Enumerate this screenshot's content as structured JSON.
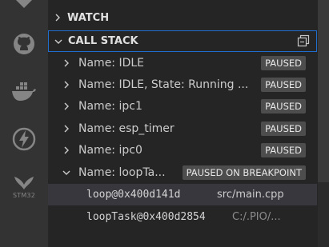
{
  "activity_bar": {
    "icons": [
      "extensions-icon",
      "github-icon",
      "docker-icon",
      "lightning-icon",
      "stm32-icon"
    ],
    "stm32_label": "STM32"
  },
  "sections": {
    "watch_title": "WATCH",
    "call_stack_title": "CALL STACK"
  },
  "threads": [
    {
      "label": "Name: IDLE",
      "status": "PAUSED",
      "expanded": false
    },
    {
      "label": "Name: IDLE, State: Running ...",
      "status": "PAUSED",
      "expanded": false
    },
    {
      "label": "Name: ipc1",
      "status": "PAUSED",
      "expanded": false
    },
    {
      "label": "Name: esp_timer",
      "status": "PAUSED",
      "expanded": false
    },
    {
      "label": "Name: ipc0",
      "status": "PAUSED",
      "expanded": false
    },
    {
      "label": "Name: loopTa...",
      "status": "PAUSED ON BREAKPOINT",
      "expanded": true
    }
  ],
  "frames": [
    {
      "name": "loop@0x400d141d",
      "source": "src/main.cpp",
      "selected": true
    },
    {
      "name": "loopTask@0x400d2854",
      "source": "C:/.PIO/...",
      "selected": false
    }
  ],
  "colors": {
    "accent_border": "#1f6ecf",
    "badge_bg": "#4d4d4d",
    "activity_bg": "#333333",
    "sidebar_bg": "#252526"
  }
}
